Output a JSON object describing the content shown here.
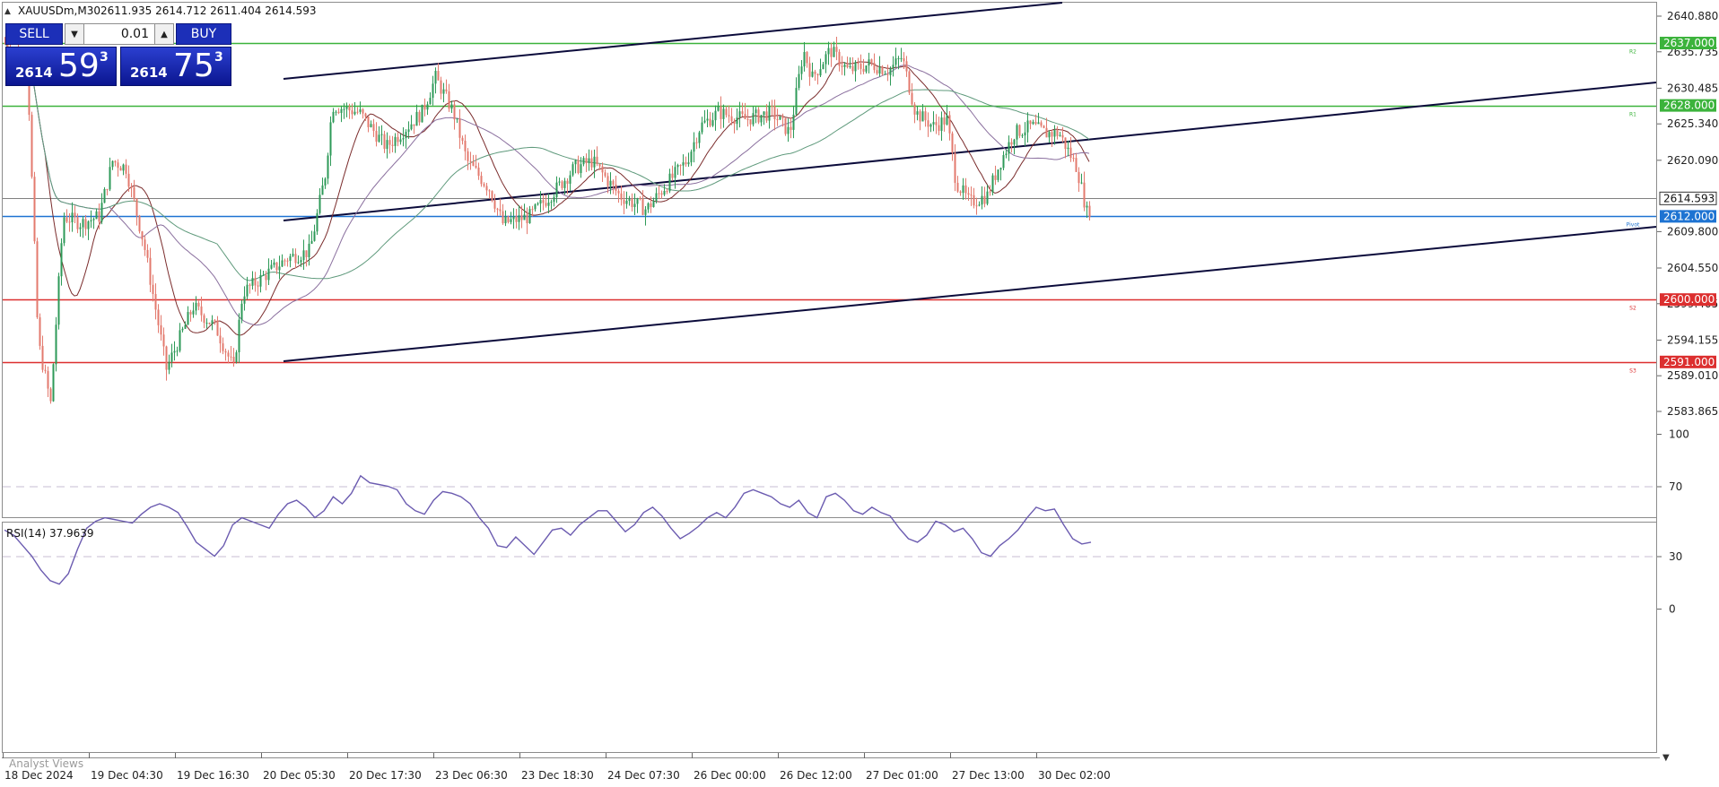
{
  "header": {
    "symbol_info": "XAUUSDm,M30",
    "ohlc": "2611.935 2614.712 2611.404 2614.593"
  },
  "trade_panel": {
    "sell_label": "SELL",
    "buy_label": "BUY",
    "lot_value": "0.01",
    "bid": {
      "big_prefix": "2614",
      "big": "59",
      "sup": "3"
    },
    "ask": {
      "big_prefix": "2614",
      "big": "75",
      "sup": "3"
    },
    "colors": {
      "button": "#1c2fb8",
      "box_top": "#2b3fd0",
      "box_bottom": "#0b1690"
    }
  },
  "price_axis": {
    "ticks": [
      "2640.880",
      "2635.735",
      "2630.485",
      "2625.340",
      "2620.090",
      "2614.593",
      "2612.000",
      "2609.800",
      "2604.550",
      "2600.000",
      "2594.155",
      "2591.000",
      "2589.010",
      "2583.865"
    ],
    "tick_values": [
      2640.88,
      2635.735,
      2630.485,
      2625.34,
      2620.09,
      2609.8,
      2604.55,
      2599.405,
      2594.155,
      2589.01,
      2583.865
    ],
    "current_price": "2614.593"
  },
  "levels": [
    {
      "name": "R2",
      "price_label": "2637.000",
      "price": 2637.0,
      "color": "#3cb33c",
      "tag": "R2"
    },
    {
      "name": "R1",
      "price_label": "2628.000",
      "price": 2628.0,
      "color": "#3cb33c",
      "tag": "R1"
    },
    {
      "name": "Pivot",
      "price_label": "2612.000",
      "price": 2612.0,
      "color": "#1e73d2",
      "tag": "Pivot"
    },
    {
      "name": "S2",
      "price_label": "2600.000",
      "price": 2600.0,
      "color": "#dc2f2f",
      "tag": "S2"
    },
    {
      "name": "S3",
      "price_label": "2591.000",
      "price": 2591.0,
      "color": "#dc2f2f",
      "tag": "S3"
    }
  ],
  "current_price_line": {
    "price": 2614.593,
    "color": "#808080"
  },
  "rsi": {
    "label": "RSI(14) 37.9639",
    "levels": [
      100,
      70,
      30,
      0
    ],
    "color": "#6b5bb0",
    "values": [
      45,
      42,
      36,
      30,
      22,
      16,
      14,
      20,
      34,
      46,
      50,
      52,
      51,
      50,
      49,
      54,
      58,
      60,
      58,
      55,
      47,
      38,
      34,
      30,
      36,
      48,
      52,
      50,
      48,
      46,
      54,
      60,
      62,
      58,
      52,
      56,
      64,
      60,
      66,
      76,
      72,
      71,
      70,
      68,
      60,
      56,
      54,
      62,
      67,
      66,
      64,
      60,
      52,
      46,
      36,
      35,
      41,
      36,
      31,
      38,
      45,
      46,
      42,
      48,
      52,
      56,
      56,
      50,
      44,
      48,
      55,
      58,
      53,
      46,
      40,
      43,
      47,
      52,
      55,
      52,
      58,
      66,
      68,
      66,
      64,
      60,
      58,
      62,
      55,
      52,
      64,
      66,
      62,
      56,
      54,
      58,
      55,
      53,
      46,
      40,
      38,
      42,
      50,
      48,
      44,
      46,
      40,
      32,
      30,
      36,
      40,
      45,
      52,
      58,
      56,
      57,
      48,
      40,
      37,
      38
    ],
    "colors": {
      "levels_line": "#c7bcd3"
    }
  },
  "time_axis": {
    "labels": [
      "18 Dec 2024",
      "19 Dec 04:30",
      "19 Dec 16:30",
      "20 Dec 05:30",
      "20 Dec 17:30",
      "23 Dec 06:30",
      "23 Dec 18:30",
      "24 Dec 07:30",
      "26 Dec 00:00",
      "26 Dec 12:00",
      "27 Dec 01:00",
      "27 Dec 13:00",
      "30 Dec 02:00"
    ]
  },
  "bottom_tab": "Analyst Views",
  "ma_colors": {
    "ma_fast": "#7a2b2b",
    "ma_mid": "#8a6f9e",
    "ma_slow": "#5f9a7c"
  },
  "channel_color": "#0b0b3b",
  "candle_colors": {
    "up": "#2e9a58",
    "down": "#e37a6e"
  }
}
